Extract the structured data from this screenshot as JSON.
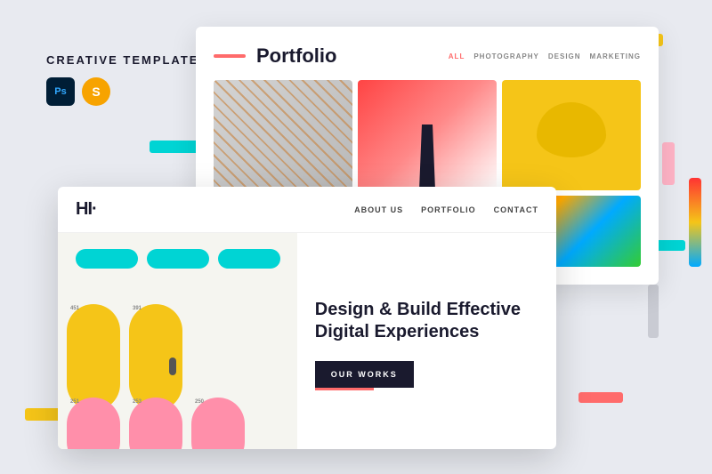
{
  "label": {
    "title": "CReATIvE templATe",
    "ps": "Ps",
    "sk": "S"
  },
  "portfolio": {
    "line_color": "#ff6b6b",
    "title": "Portfolio",
    "nav": {
      "all": "ALL",
      "photography": "PHOTOGRAPHY",
      "design": "DESIGN",
      "marketing": "MARKETING"
    }
  },
  "main_site": {
    "logo": "HI·",
    "nav": {
      "about": "ABOUT US",
      "portfolio": "PORTFOLIO",
      "contact": "CONTACT"
    },
    "headline": "Design & Build Effective Digital Experiences",
    "cta": "OUR WORKS"
  },
  "decorations": {
    "cyan": "#00d4d4",
    "yellow": "#f5c518",
    "pink": "#ffb3c6",
    "red": "#ff6b6b"
  }
}
